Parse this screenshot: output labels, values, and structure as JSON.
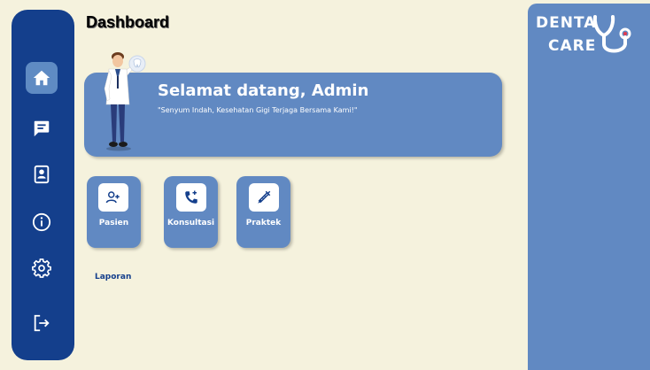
{
  "page": {
    "title": "Dashboard"
  },
  "sidebar": {
    "items": [
      {
        "icon": "home-icon",
        "active": true
      },
      {
        "icon": "chat-icon",
        "active": false
      },
      {
        "icon": "contact-card-icon",
        "active": false
      },
      {
        "icon": "info-icon",
        "active": false
      },
      {
        "icon": "gear-icon",
        "active": false
      },
      {
        "icon": "logout-icon",
        "active": false
      }
    ]
  },
  "banner": {
    "greeting": "Selamat datang, Admin",
    "tagline": "\"Senyum Indah, Kesehatan Gigi Terjaga Bersama Kami!\""
  },
  "cards": [
    {
      "label": "Pasien",
      "icon": "add-user-icon"
    },
    {
      "label": "Konsultasi",
      "icon": "phone-plus-icon"
    },
    {
      "label": "Praktek",
      "icon": "syringe-icon"
    }
  ],
  "report": {
    "label": "Laporan"
  },
  "brand": {
    "line1": "DENTA",
    "line2": "CARE",
    "logo_icon": "stethoscope-icon"
  },
  "colors": {
    "background": "#f5f2dd",
    "sidebar": "#143f8c",
    "accent": "#6189c2",
    "white": "#ffffff"
  }
}
